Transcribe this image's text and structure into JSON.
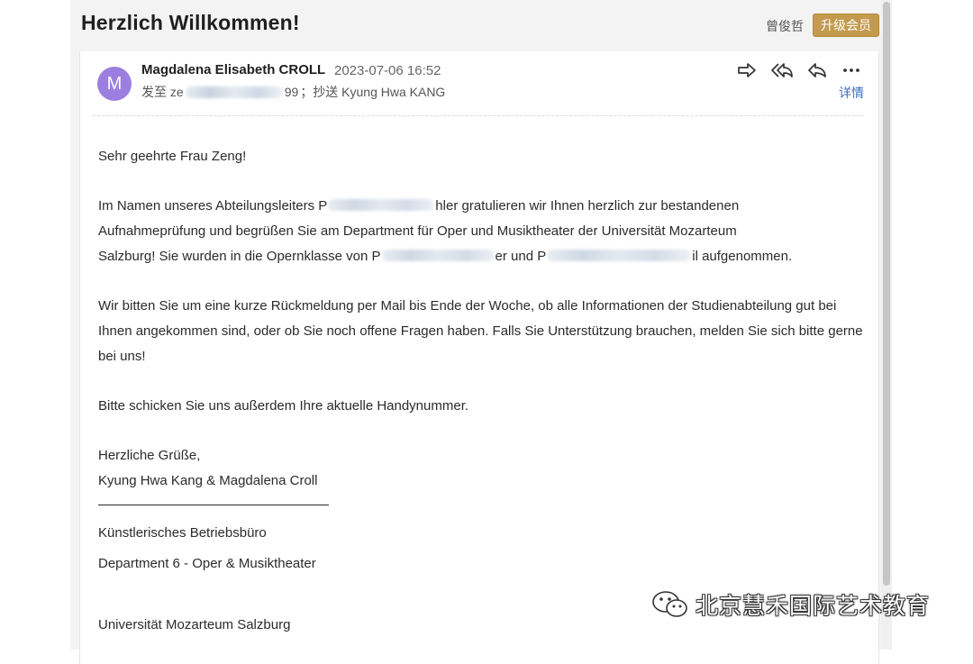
{
  "header": {
    "subject": "Herzlich Willkommen!",
    "user_name": "曾俊哲",
    "upgrade_label": "升级会员"
  },
  "mail": {
    "avatar_letter": "M",
    "sender": "Magdalena Elisabeth CROLL",
    "date": "2023-07-06 16:52",
    "to_label": "发至",
    "to_visible_start": "ze",
    "to_visible_end": "99",
    "cc_label": "；抄送",
    "cc_name": "Kyung Hwa KANG",
    "details_label": "详情",
    "icons": [
      "forward-icon",
      "reply-all-icon",
      "reply-icon",
      "more-icon"
    ]
  },
  "body": {
    "greeting": "Sehr geehrte Frau Zeng!",
    "p1_a": "Im Namen unseres Abteilungsleiters P",
    "p1_b": "hler gratulieren wir Ihnen herzlich zur bestandenen",
    "p1_c": "Aufnahmeprüfung und begrüßen Sie am Department für Oper und Musiktheater der Universität Mozarteum",
    "p1_d": "Salzburg! Sie wurden in die Opernklasse von P",
    "p1_e": "er und P",
    "p1_f": "il aufgenommen.",
    "p2": "Wir bitten Sie um eine kurze Rückmeldung per Mail bis Ende der Woche, ob alle Informationen der Studienabteilung gut bei Ihnen angekommen sind, oder ob Sie noch offene Fragen haben. Falls Sie Unterstützung brauchen, melden Sie sich bitte gerne bei uns!",
    "p3": "Bitte schicken Sie uns außerdem Ihre aktuelle Handynummer.",
    "closing": "Herzliche Grüße,",
    "signers": "Kyung Hwa Kang & Magdalena Croll",
    "org1": "Künstlerisches Betriebsbüro",
    "org2": "Department 6 - Oper & Musiktheater",
    "org3": "Universität Mozarteum Salzburg"
  },
  "watermark": {
    "text": "北京慧禾国际艺术教育",
    "icon": "wechat-icon"
  },
  "colors": {
    "accent_gold": "#c49a4e",
    "avatar_purple": "#9b7fe0",
    "link_blue": "#3a6fc4"
  }
}
